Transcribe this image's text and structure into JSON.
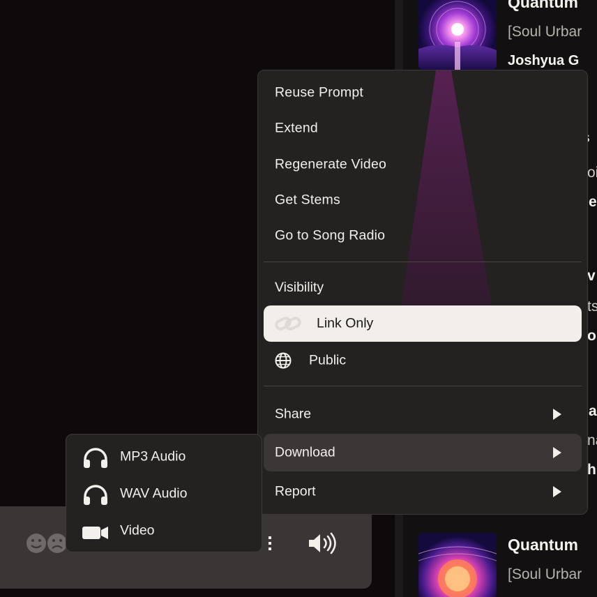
{
  "songs": [
    {
      "title": "Quantum",
      "tags": "[Soul Urbar",
      "artist": "Joshyua G"
    },
    {
      "title": "Quantum",
      "tags": "[Soul Urbar"
    }
  ],
  "partial_fragments": [
    "s",
    "oi",
    "e",
    "v",
    "ts",
    "or",
    "a",
    "na",
    "h"
  ],
  "menu": {
    "items": [
      {
        "label": "Reuse Prompt"
      },
      {
        "label": "Extend"
      },
      {
        "label": "Regenerate Video"
      },
      {
        "label": "Get Stems"
      },
      {
        "label": "Go to Song Radio"
      }
    ],
    "visibility_label": "Visibility",
    "visibility_options": [
      {
        "label": "Link Only",
        "icon": "link-icon",
        "selected": true
      },
      {
        "label": "Public",
        "icon": "globe-icon",
        "selected": false
      }
    ],
    "submenus": [
      {
        "label": "Share"
      },
      {
        "label": "Download"
      },
      {
        "label": "Report"
      }
    ]
  },
  "download_submenu": {
    "items": [
      {
        "label": "MP3 Audio",
        "icon": "headphones-icon"
      },
      {
        "label": "WAV Audio",
        "icon": "headphones-icon"
      },
      {
        "label": "Video",
        "icon": "video-camera-icon"
      }
    ]
  },
  "colors": {
    "menu_bg": "#242121",
    "selected_bg": "#f2efea",
    "highlight_bg": "#3b3737"
  }
}
